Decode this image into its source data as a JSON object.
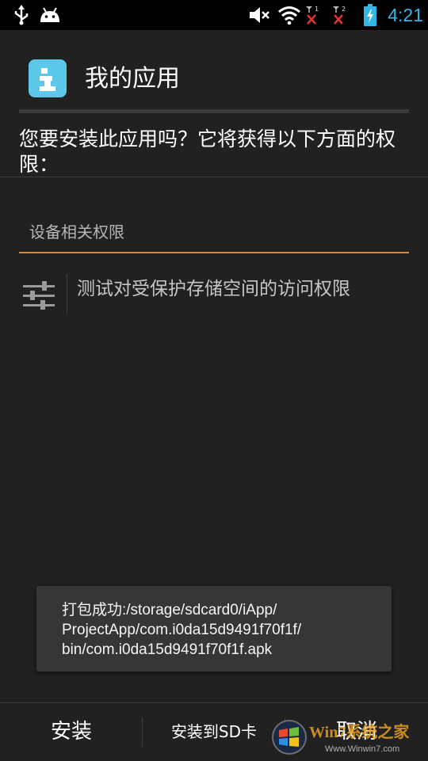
{
  "status_bar": {
    "time": "4:21",
    "sim1_label": "1",
    "sim2_label": "2",
    "icons": [
      "usb-icon",
      "android-icon",
      "mute-icon",
      "wifi-icon",
      "sim1-no-signal-icon",
      "sim2-no-signal-icon",
      "battery-charging-icon"
    ],
    "time_color": "#33b5e5"
  },
  "header": {
    "app_title": "我的应用",
    "app_icon": "info-app-icon",
    "app_icon_color": "#5bc8ea"
  },
  "prompt": {
    "question": "您要安装此应用吗？它将获得以下方面的权限："
  },
  "permissions": {
    "category": "设备相关权限",
    "accent_color": "#e8852c",
    "items": [
      {
        "icon": "sliders-icon",
        "label": "测试对受保护存储空间的访问权限"
      }
    ]
  },
  "toast": {
    "line1": "打包成功:/storage/sdcard0/iApp/",
    "line2": "ProjectApp/com.i0da15d9491f70f1f/",
    "line3": "bin/com.i0da15d9491f70f1f.apk"
  },
  "actions": {
    "install": "安装",
    "install_sd": "安装到SD卡",
    "cancel": "取消"
  },
  "watermark": {
    "text": "Win7系统之家",
    "url": "Www.Winwin7.com"
  }
}
